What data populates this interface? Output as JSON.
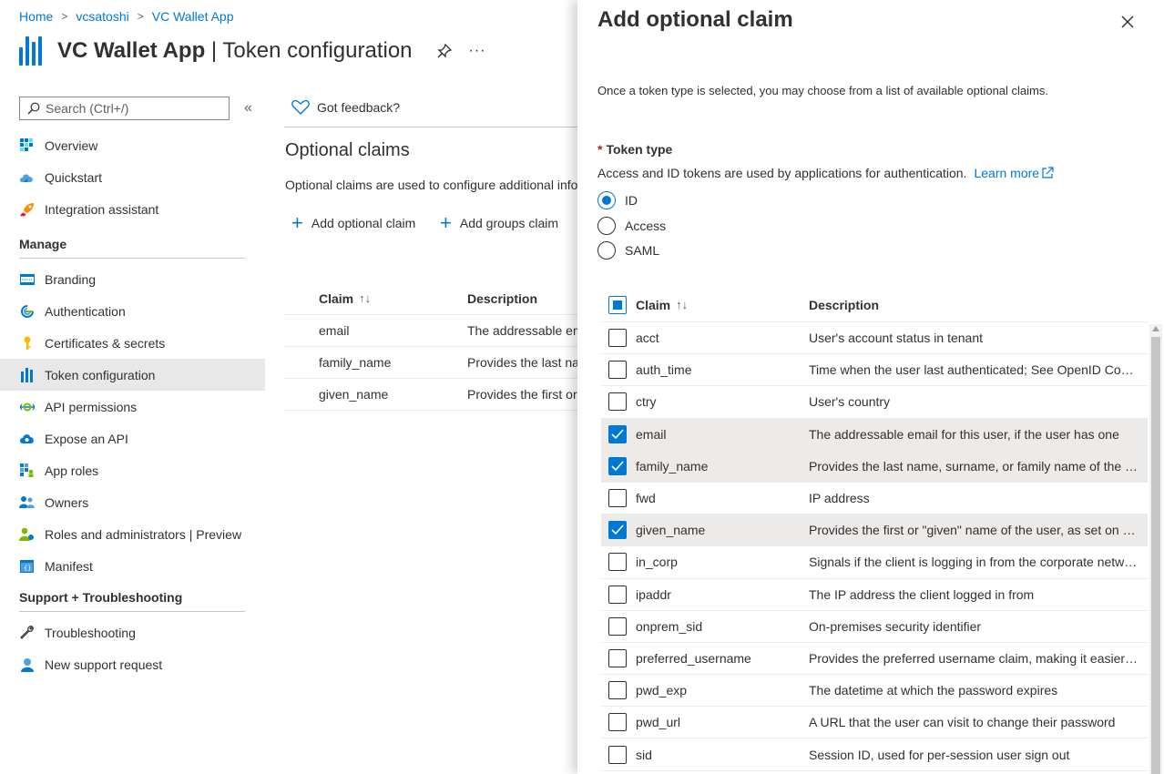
{
  "breadcrumb": [
    "Home",
    "vcsatoshi",
    "VC Wallet App"
  ],
  "header": {
    "app_name": "VC Wallet App",
    "separator": " | ",
    "page": "Token configuration",
    "more": "···"
  },
  "sidebar": {
    "search_placeholder": "Search (Ctrl+/)",
    "collapse": "«",
    "top_items": [
      {
        "label": "Overview",
        "icon": "overview-icon"
      },
      {
        "label": "Quickstart",
        "icon": "quickstart-icon"
      },
      {
        "label": "Integration assistant",
        "icon": "rocket-icon"
      }
    ],
    "manage_title": "Manage",
    "manage_items": [
      {
        "label": "Branding",
        "icon": "branding-icon"
      },
      {
        "label": "Authentication",
        "icon": "authentication-icon"
      },
      {
        "label": "Certificates & secrets",
        "icon": "key-icon"
      },
      {
        "label": "Token configuration",
        "icon": "token-icon",
        "active": true
      },
      {
        "label": "API permissions",
        "icon": "api-permissions-icon"
      },
      {
        "label": "Expose an API",
        "icon": "cloud-icon"
      },
      {
        "label": "App roles",
        "icon": "app-roles-icon"
      },
      {
        "label": "Owners",
        "icon": "owners-icon"
      },
      {
        "label": "Roles and administrators | Preview",
        "icon": "roles-icon"
      },
      {
        "label": "Manifest",
        "icon": "manifest-icon"
      }
    ],
    "support_title": "Support + Troubleshooting",
    "support_items": [
      {
        "label": "Troubleshooting",
        "icon": "wrench-icon"
      },
      {
        "label": "New support request",
        "icon": "support-person-icon"
      }
    ]
  },
  "main": {
    "feedback": "Got feedback?",
    "section_title": "Optional claims",
    "section_desc": "Optional claims are used to configure additional information",
    "add_optional_claim": "Add optional claim",
    "add_groups_claim": "Add groups claim",
    "table_headers": [
      "Claim",
      "Description"
    ],
    "sort_glyph": "↑↓",
    "rows": [
      {
        "claim": "email",
        "description": "The addressable email"
      },
      {
        "claim": "family_name",
        "description": "Provides the last name"
      },
      {
        "claim": "given_name",
        "description": "Provides the first or"
      }
    ]
  },
  "panel": {
    "title": "Add optional claim",
    "intro": "Once a token type is selected, you may choose from a list of available optional claims.",
    "token_type_required": "*",
    "token_type_label": "Token type",
    "token_type_desc": "Access and ID tokens are used by applications for authentication.",
    "learn_more": "Learn more",
    "token_types": [
      {
        "label": "ID",
        "checked": true
      },
      {
        "label": "Access",
        "checked": false
      },
      {
        "label": "SAML",
        "checked": false
      }
    ],
    "table_headers": [
      "Claim",
      "Description"
    ],
    "sort_glyph": "↑↓",
    "claims": [
      {
        "claim": "acct",
        "description": "User's account status in tenant",
        "checked": false
      },
      {
        "claim": "auth_time",
        "description": "Time when the user last authenticated; See OpenID Connect spec",
        "checked": false
      },
      {
        "claim": "ctry",
        "description": "User's country",
        "checked": false
      },
      {
        "claim": "email",
        "description": "The addressable email for this user, if the user has one",
        "checked": true
      },
      {
        "claim": "family_name",
        "description": "Provides the last name, surname, or family name of the user",
        "checked": true
      },
      {
        "claim": "fwd",
        "description": "IP address",
        "checked": false
      },
      {
        "claim": "given_name",
        "description": "Provides the first or \"given\" name of the user, as set on the user object",
        "checked": true
      },
      {
        "claim": "in_corp",
        "description": "Signals if the client is logging in from the corporate network",
        "checked": false
      },
      {
        "claim": "ipaddr",
        "description": "The IP address the client logged in from",
        "checked": false
      },
      {
        "claim": "onprem_sid",
        "description": "On-premises security identifier",
        "checked": false
      },
      {
        "claim": "preferred_username",
        "description": "Provides the preferred username claim, making it easier for apps",
        "checked": false
      },
      {
        "claim": "pwd_exp",
        "description": "The datetime at which the password expires",
        "checked": false
      },
      {
        "claim": "pwd_url",
        "description": "A URL that the user can visit to change their password",
        "checked": false
      },
      {
        "claim": "sid",
        "description": "Session ID, used for per-session user sign out",
        "checked": false
      }
    ]
  },
  "colors": {
    "accent": "#0078d4",
    "selected_row": "#edebe9",
    "required": "#a4262c"
  }
}
